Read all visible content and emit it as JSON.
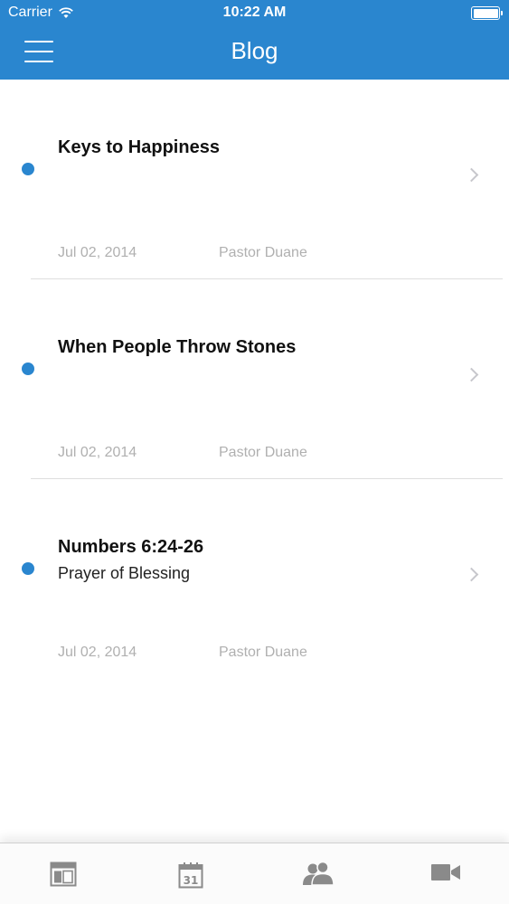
{
  "status_bar": {
    "carrier": "Carrier",
    "time": "10:22 AM"
  },
  "nav": {
    "title": "Blog",
    "menu_icon": "hamburger-menu-icon"
  },
  "posts": [
    {
      "title": "Keys to Happiness",
      "subtitle": "",
      "date": "Jul 02, 2014",
      "author": "Pastor Duane"
    },
    {
      "title": "When People Throw Stones",
      "subtitle": "",
      "date": "Jul 02, 2014",
      "author": "Pastor Duane"
    },
    {
      "title": "Numbers 6:24-26",
      "subtitle": "Prayer of Blessing",
      "date": "Jul 02, 2014",
      "author": "Pastor Duane"
    }
  ],
  "tabs": [
    {
      "icon": "layout-icon"
    },
    {
      "icon": "calendar-icon",
      "day": "31"
    },
    {
      "icon": "people-icon"
    },
    {
      "icon": "video-camera-icon"
    }
  ],
  "colors": {
    "accent": "#2a86cf",
    "tab_icon": "#8a8a8a",
    "meta_text": "#b0b0b0"
  }
}
